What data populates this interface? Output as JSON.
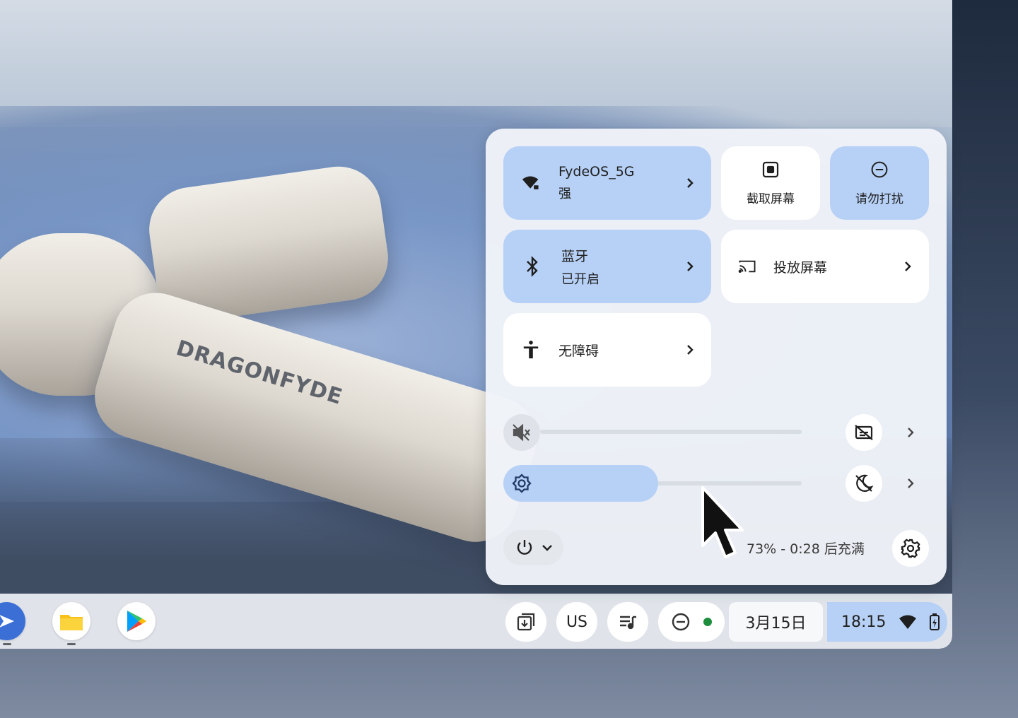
{
  "quick_settings": {
    "wifi": {
      "name": "FydeOS_5G",
      "strength": "强"
    },
    "screenshot": {
      "label": "截取屏幕"
    },
    "dnd": {
      "label": "请勿打扰"
    },
    "bluetooth": {
      "name": "蓝牙",
      "status": "已开启"
    },
    "cast": {
      "label": "投放屏幕"
    },
    "accessibility": {
      "label": "无障碍"
    },
    "volume": {
      "level_percent": 0,
      "muted": true
    },
    "brightness": {
      "level_percent": 45
    },
    "battery_text": "73% - 0:28 后充满"
  },
  "shelf": {
    "ime_label": "US",
    "date": "3月15日",
    "time": "18:15"
  },
  "colors": {
    "accent_tile": "#b7d1f6",
    "panel_bg": "#f0f3f8",
    "dnd_dot": "#1e8e3e"
  },
  "icons": [
    "wifi-lock-icon",
    "screenshot-icon",
    "dnd-icon",
    "bluetooth-icon",
    "cast-icon",
    "accessibility-icon",
    "volume-mute-icon",
    "caption-off-icon",
    "brightness-icon",
    "night-light-off-icon",
    "power-icon",
    "settings-gear-icon",
    "launcher-icon",
    "files-icon",
    "play-store-icon",
    "holding-space-icon",
    "media-controls-icon",
    "wifi-icon",
    "battery-charging-icon"
  ]
}
